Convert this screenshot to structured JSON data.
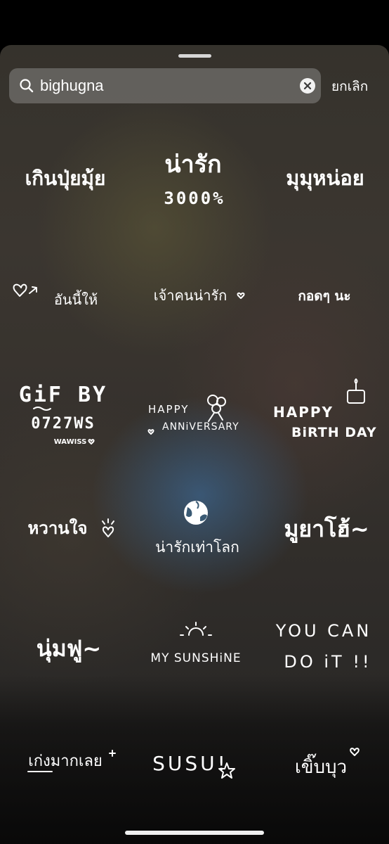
{
  "search": {
    "value": "bighugna",
    "cancel_label": "ยกเลิก"
  },
  "icons": {
    "search": "magnifying-glass-icon",
    "clear": "clear-x-circle-icon"
  },
  "stickers": [
    {
      "lines": [
        "เกินปุ่ยมุ้ย"
      ]
    },
    {
      "lines": [
        "น่ารัก",
        "3000%"
      ]
    },
    {
      "lines": [
        "มุมุหน่อย"
      ]
    },
    {
      "lines": [
        "อันนี้ให้"
      ]
    },
    {
      "lines": [
        "เจ้าคนน่ารัก"
      ]
    },
    {
      "lines": [
        "กอดๆ นะ"
      ]
    },
    {
      "lines": [
        "GiF BY",
        "0727WS",
        "WAWISS"
      ]
    },
    {
      "lines": [
        "HAPPY",
        "ANNiVERSARY"
      ]
    },
    {
      "lines": [
        "HAPPY",
        "BiRTH DAY"
      ]
    },
    {
      "lines": [
        "หวานใจ"
      ]
    },
    {
      "lines": [
        "น่ารักเท่าโลก"
      ]
    },
    {
      "lines": [
        "มูยาโฮ้~"
      ]
    },
    {
      "lines": [
        "นุ่มฟู~"
      ]
    },
    {
      "lines": [
        "MY SUNSHiNE"
      ]
    },
    {
      "lines": [
        "YOU CAN",
        "DO iT !!"
      ]
    },
    {
      "lines": [
        "เก่งมากเลย"
      ]
    },
    {
      "lines": [
        "SUSU!"
      ]
    },
    {
      "lines": [
        "เขิ๊บบุว"
      ]
    }
  ]
}
